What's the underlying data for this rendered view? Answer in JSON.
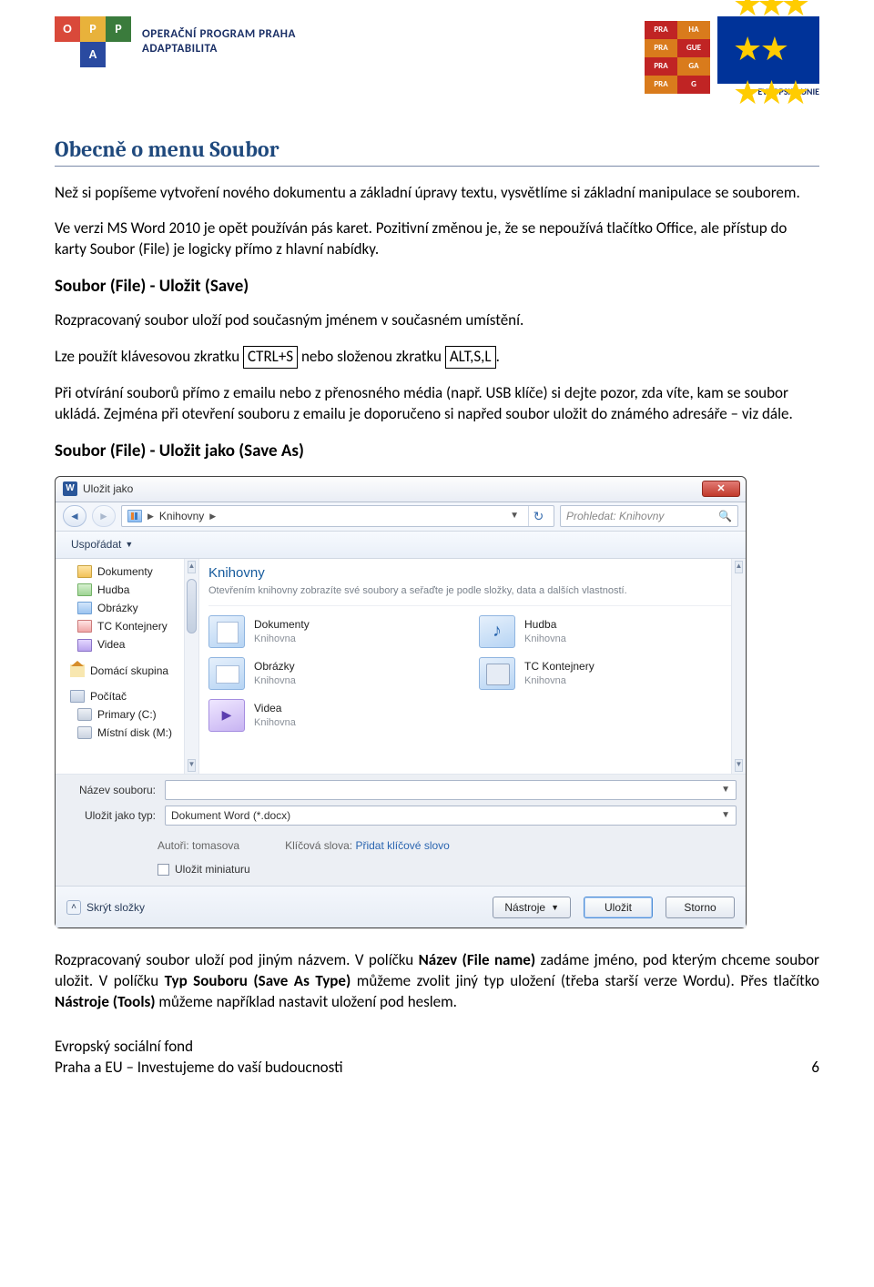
{
  "header": {
    "oppa_title_line1": "OPERAČNÍ PROGRAM PRAHA",
    "oppa_title_line2": "ADAPTABILITA",
    "eu_caption": "EVROPSKÁ UNIE",
    "prag_cells": [
      "PRA",
      "HA",
      "PRA",
      "GUE",
      "PRA",
      "GA",
      "PRA",
      "G"
    ]
  },
  "content": {
    "h1": "Obecně o menu Soubor",
    "p1": "Než si popíšeme vytvoření nového dokumentu a základní úpravy textu, vysvětlíme si základní manipulace se souborem.",
    "p2": "Ve verzi MS Word 2010 je opět používán pás karet. Pozitivní změnou je, že se nepoužívá tlačítko Office, ale přístup do karty Soubor (File) je logicky přímo z hlavní nabídky.",
    "sub1": "Soubor (File) - Uložit (Save)",
    "p3": "Rozpracovaný soubor uloží pod současným jménem v současném umístění.",
    "p4_before": "Lze použít klávesovou zkratku ",
    "kbd1": "CTRL+S",
    "p4_mid": " nebo složenou zkratku ",
    "kbd2": "ALT,S,L",
    "p4_after": ".",
    "p5": "Při otvírání souborů přímo z emailu nebo z přenosného média (např. USB klíče) si dejte pozor, zda víte, kam se soubor ukládá. Zejména při otevření souboru z emailu je doporučeno si napřed soubor uložit do známého adresáře – viz dále.",
    "sub2": "Soubor (File) - Uložit jako (Save As)",
    "p6_a": "Rozpracovaný soubor uloží pod jiným názvem. V políčku ",
    "p6_b": "Název (File name)",
    "p6_c": " zadáme jméno, pod kterým chceme soubor uložit. V políčku ",
    "p6_d": "Typ Souboru (Save As Type)",
    "p6_e": " můžeme zvolit jiný typ uložení (třeba starší verze Wordu). Přes tlačítko ",
    "p6_f": "Nástroje (Tools)",
    "p6_g": " můžeme například nastavit uložení pod heslem."
  },
  "dialog": {
    "title": "Uložit jako",
    "breadcrumb": "Knihovny",
    "search_placeholder": "Prohledat: Knihovny",
    "toolbar_organize": "Uspořádat",
    "nav_items": [
      {
        "label": "Dokumenty",
        "cls": "ic-folder",
        "sub": true
      },
      {
        "label": "Hudba",
        "cls": "ic-music",
        "sub": true
      },
      {
        "label": "Obrázky",
        "cls": "ic-pic",
        "sub": true
      },
      {
        "label": "TC Kontejnery",
        "cls": "ic-tc",
        "sub": true
      },
      {
        "label": "Videa",
        "cls": "ic-vid",
        "sub": true
      }
    ],
    "nav_group2": {
      "label": "Domácí skupina",
      "cls": "ic-home"
    },
    "nav_group3": [
      {
        "label": "Počítač",
        "cls": "ic-pc"
      },
      {
        "label": "Primary (C:)",
        "cls": "ic-drive",
        "sub": true
      },
      {
        "label": "Místní disk (M:)",
        "cls": "ic-drive",
        "sub": true
      }
    ],
    "main_title": "Knihovny",
    "main_subtitle": "Otevřením knihovny zobrazíte své soubory a seřaďte je podle složky, data a dalších vlastností.",
    "libs": [
      {
        "name": "Dokumenty",
        "sub": "Knihovna",
        "cls": "docs"
      },
      {
        "name": "Hudba",
        "sub": "Knihovna",
        "cls": "music"
      },
      {
        "name": "Obrázky",
        "sub": "Knihovna",
        "cls": "pics"
      },
      {
        "name": "TC Kontejnery",
        "sub": "Knihovna",
        "cls": "tc"
      },
      {
        "name": "Videa",
        "sub": "Knihovna",
        "cls": "vid"
      }
    ],
    "field_filename_label": "Název souboru:",
    "field_filename_value": "",
    "field_type_label": "Uložit jako typ:",
    "field_type_value": "Dokument Word (*.docx)",
    "authors_label": "Autoři:",
    "authors_value": "tomasova",
    "tags_label": "Klíčová slova:",
    "tags_value": "Přidat klíčové slovo",
    "save_thumbnail": "Uložit miniaturu",
    "hide_folders": "Skrýt složky",
    "tools_btn": "Nástroje",
    "save_btn": "Uložit",
    "cancel_btn": "Storno"
  },
  "footer": {
    "line1": "Evropský sociální fond",
    "line2": "Praha a EU – Investujeme do vaší budoucnosti",
    "page": "6"
  }
}
